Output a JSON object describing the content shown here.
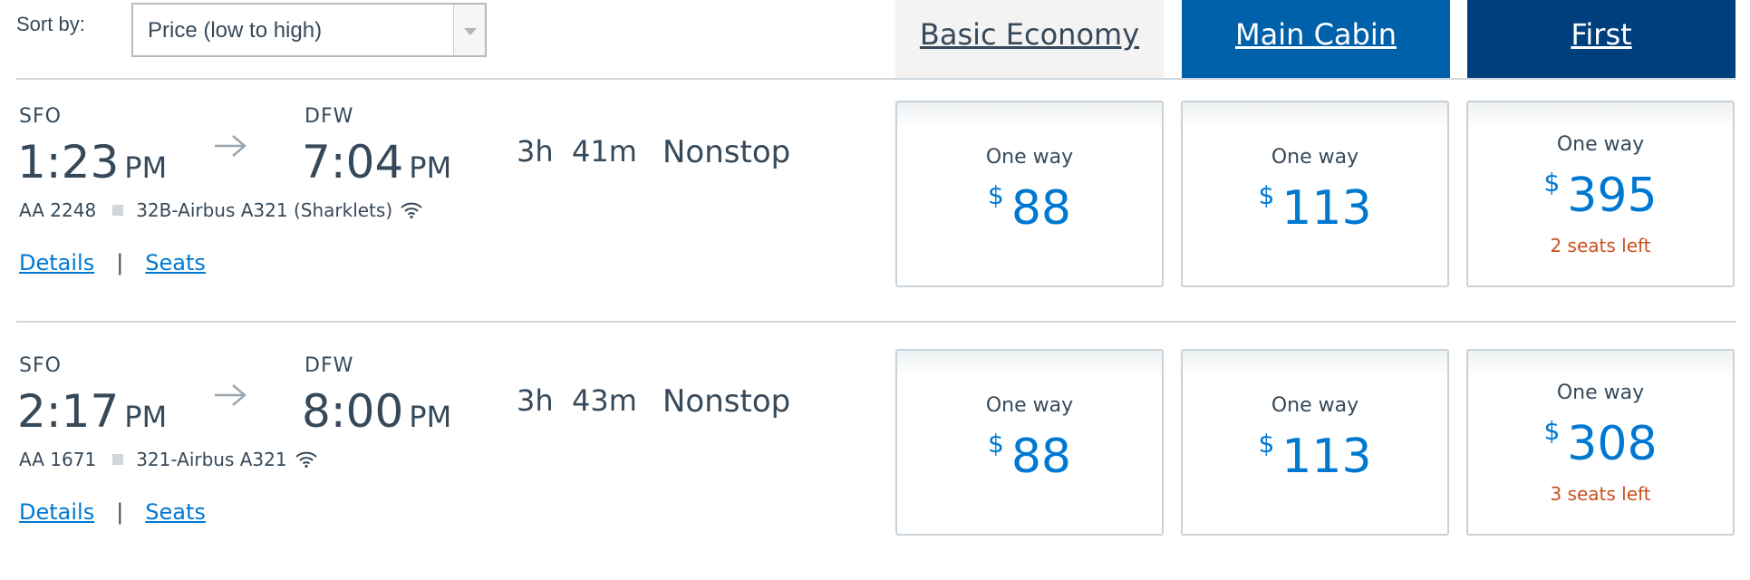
{
  "sort": {
    "label": "Sort by:",
    "selected": "Price (low to high)"
  },
  "cabins": {
    "basic": "Basic Economy",
    "main": "Main Cabin",
    "first": "First"
  },
  "colors": {
    "main_tab": "#0061ab",
    "first_tab": "#003f7d",
    "price": "#0078d2",
    "seats_left": "#c9501c"
  },
  "flights": [
    {
      "origin": "SFO",
      "depart_time": "1:23",
      "depart_ampm": "PM",
      "destination": "DFW",
      "arrive_time": "7:04",
      "arrive_ampm": "PM",
      "duration": "3h  41m",
      "stops": "Nonstop",
      "flight_number": "AA 2248",
      "aircraft": "32B-Airbus A321 (Sharklets)",
      "details_link": "Details",
      "seats_link": "Seats",
      "fares": {
        "basic": {
          "label": "One way",
          "currency": "$",
          "amount": "88",
          "seats_left": ""
        },
        "main": {
          "label": "One way",
          "currency": "$",
          "amount": "113",
          "seats_left": ""
        },
        "first": {
          "label": "One way",
          "currency": "$",
          "amount": "395",
          "seats_left": "2 seats left"
        }
      }
    },
    {
      "origin": "SFO",
      "depart_time": "2:17",
      "depart_ampm": "PM",
      "destination": "DFW",
      "arrive_time": "8:00",
      "arrive_ampm": "PM",
      "duration": "3h  43m",
      "stops": "Nonstop",
      "flight_number": "AA 1671",
      "aircraft": "321-Airbus A321",
      "details_link": "Details",
      "seats_link": "Seats",
      "fares": {
        "basic": {
          "label": "One way",
          "currency": "$",
          "amount": "88",
          "seats_left": ""
        },
        "main": {
          "label": "One way",
          "currency": "$",
          "amount": "113",
          "seats_left": ""
        },
        "first": {
          "label": "One way",
          "currency": "$",
          "amount": "308",
          "seats_left": "3 seats left"
        }
      }
    }
  ]
}
